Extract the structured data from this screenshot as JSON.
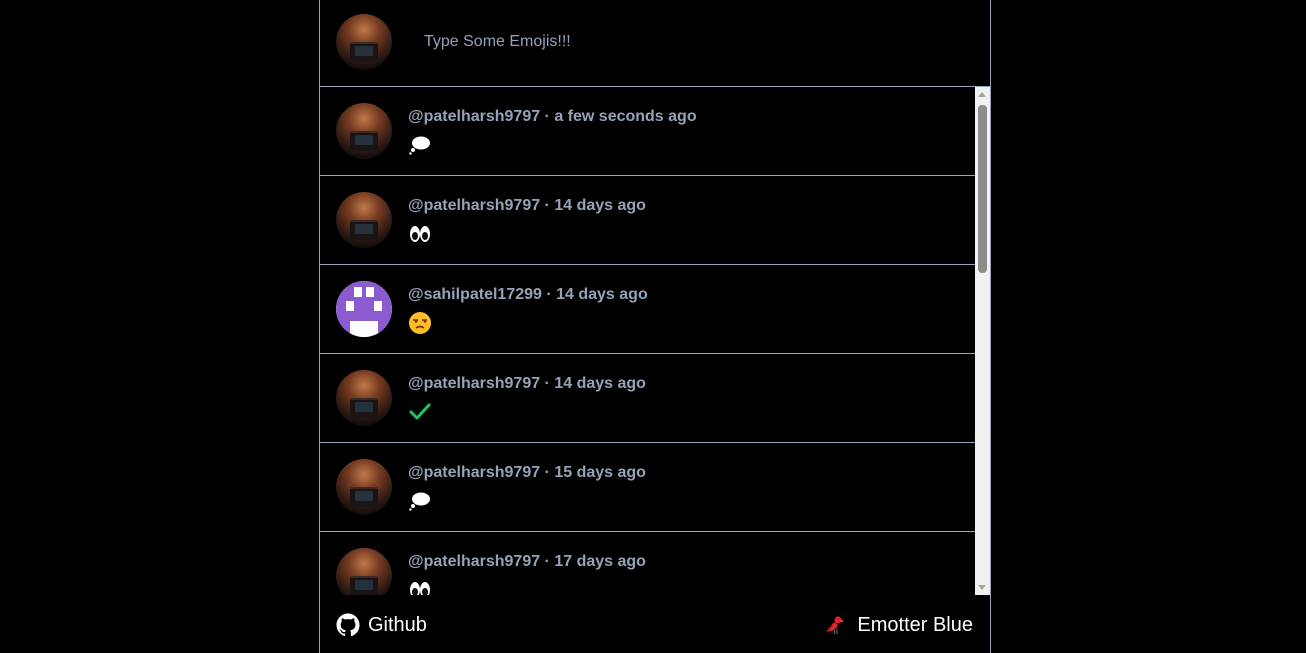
{
  "composer": {
    "placeholder": "Type Some Emojis!!!"
  },
  "posts": [
    {
      "meta": "@patelharsh9797 · a few seconds ago",
      "emoji": "thought-balloon",
      "avatar": "photo"
    },
    {
      "meta": "@patelharsh9797 · 14 days ago",
      "emoji": "eyes",
      "avatar": "photo"
    },
    {
      "meta": "@sahilpatel17299 · 14 days ago",
      "emoji": "unamused-face",
      "avatar": "identicon"
    },
    {
      "meta": "@patelharsh9797 · 14 days ago",
      "emoji": "check-mark",
      "avatar": "photo"
    },
    {
      "meta": "@patelharsh9797 · 15 days ago",
      "emoji": "thought-balloon",
      "avatar": "photo"
    },
    {
      "meta": "@patelharsh9797 · 17 days ago",
      "emoji": "eyes",
      "avatar": "photo"
    }
  ],
  "footer": {
    "github_label": "Github",
    "github_icon": "github-icon",
    "brand_label": "Emotter Blue",
    "brand_icon": "bird-icon"
  },
  "colors": {
    "background": "#000000",
    "border": "#94a3b8",
    "meta_text": "#94a3b8",
    "footer_text": "#ffffff",
    "check_green": "#22c55e",
    "identicon_purple": "#8b5ccf"
  }
}
